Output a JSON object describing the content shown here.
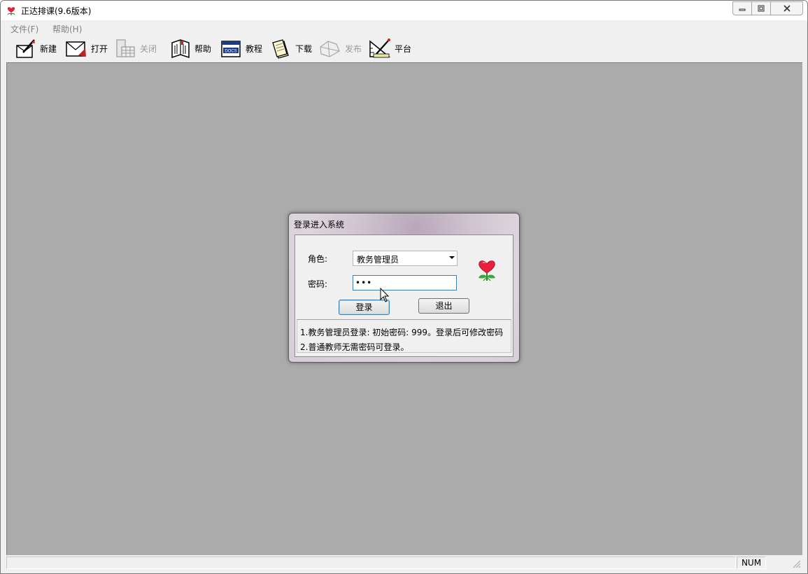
{
  "window": {
    "title": "正达排课(9.6版本)",
    "icons": {
      "app": "rose-icon",
      "minimize": "minimize-icon",
      "maximize": "maximize-icon",
      "close": "close-icon"
    }
  },
  "menu": {
    "items": [
      {
        "label": "文件(F)"
      },
      {
        "label": "帮助(H)"
      }
    ]
  },
  "toolbar": {
    "items": [
      {
        "label": "新建",
        "icon": "new-icon",
        "enabled": true
      },
      {
        "label": "打开",
        "icon": "open-icon",
        "enabled": true
      },
      {
        "label": "关闭",
        "icon": "close-file-icon",
        "enabled": false
      },
      {
        "label": "帮助",
        "icon": "help-book-icon",
        "enabled": true
      },
      {
        "label": "教程",
        "icon": "docs-icon",
        "enabled": true
      },
      {
        "label": "下载",
        "icon": "download-icon",
        "enabled": true
      },
      {
        "label": "发布",
        "icon": "publish-icon",
        "enabled": false
      },
      {
        "label": "平台",
        "icon": "platform-icon",
        "enabled": true
      }
    ]
  },
  "dialog": {
    "title": "登录进入系统",
    "role_label": "角色:",
    "role_value": "教务管理员",
    "password_label": "密码:",
    "password_value": "•••",
    "login_button": "登录",
    "exit_button": "退出",
    "notes": [
      "1.教务管理员登录: 初始密码: 999。登录后可修改密码",
      "2.普通教师无需密码可登录。"
    ],
    "icon": "rose-icon"
  },
  "status": {
    "num": "NUM"
  },
  "colors": {
    "workspace": "#ababab",
    "dialog_frame": "#cfc3cf",
    "focus_border": "#3c7fb1"
  }
}
